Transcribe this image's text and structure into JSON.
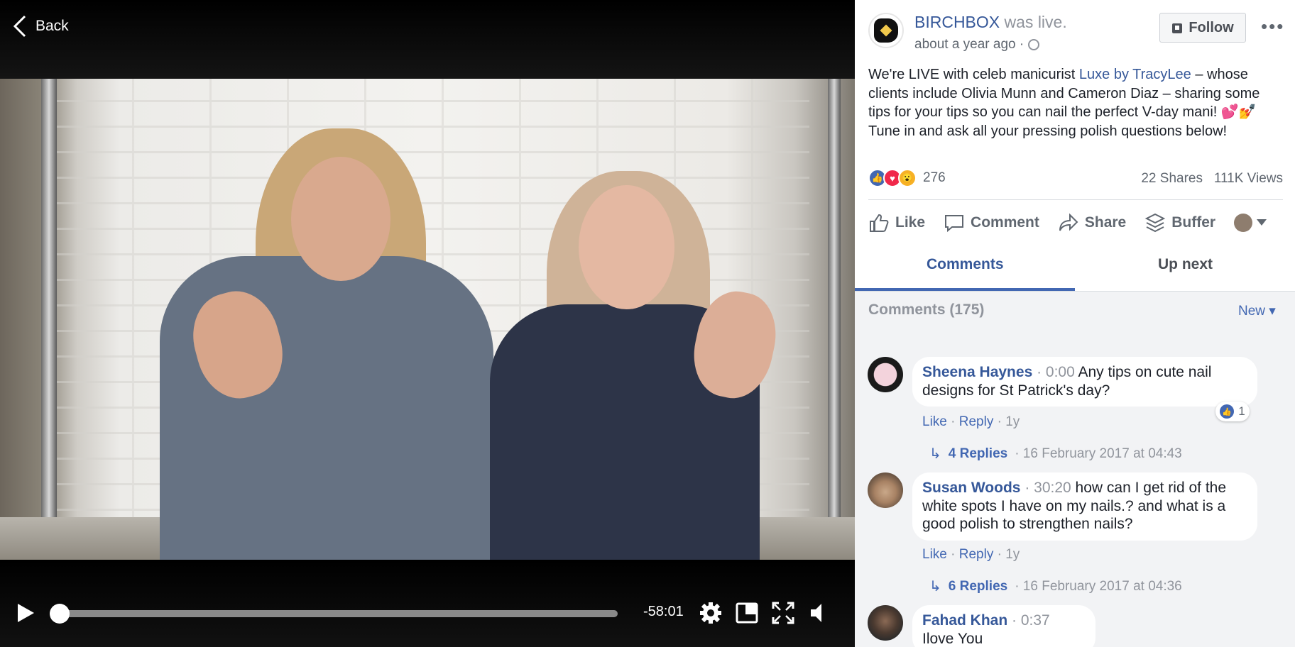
{
  "player": {
    "back_label": "Back",
    "time_remaining": "-58:01",
    "progress": 0.0
  },
  "post": {
    "page_name": "BIRCHBOX",
    "status": "was live.",
    "time": "about a year ago ·",
    "follow_label": "Follow",
    "text_1": "We're LIVE with celeb manicurist ",
    "text_link": "Luxe by TracyLee",
    "text_2": " – whose clients include Olivia Munn and Cameron Diaz – sharing some tips for your tips so you can nail the perfect V-day mani! 💕💅 Tune in and ask all your pressing polish questions below!",
    "reaction_count": "276",
    "shares": "22 Shares",
    "views": "111K Views"
  },
  "actions": {
    "like": "Like",
    "comment": "Comment",
    "share": "Share",
    "buffer": "Buffer"
  },
  "tabs": {
    "comments": "Comments",
    "up_next": "Up next"
  },
  "comments_section": {
    "header": "Comments (175)",
    "sort": "New ▾",
    "items": [
      {
        "name": "Sheena Haynes",
        "timestamp": "· 0:00",
        "text": "Any tips on cute nail designs for St Patrick's day?",
        "like": "Like",
        "reply": "Reply",
        "age": "1y",
        "likes": "1",
        "replies_label": "4 Replies",
        "replies_date": "· 16 February 2017 at 04:43"
      },
      {
        "name": "Susan Woods",
        "timestamp": "· 30:20",
        "text": "how can I get rid of the white spots I have on my nails.? and what is a good polish to strengthen nails?",
        "like": "Like",
        "reply": "Reply",
        "age": "1y",
        "replies_label": "6 Replies",
        "replies_date": "· 16 February 2017 at 04:36"
      },
      {
        "name": "Fahad Khan",
        "timestamp": "· 0:37",
        "text": "Ilove You"
      }
    ]
  },
  "colors": {
    "link": "#365899",
    "accent": "#4267b2"
  }
}
